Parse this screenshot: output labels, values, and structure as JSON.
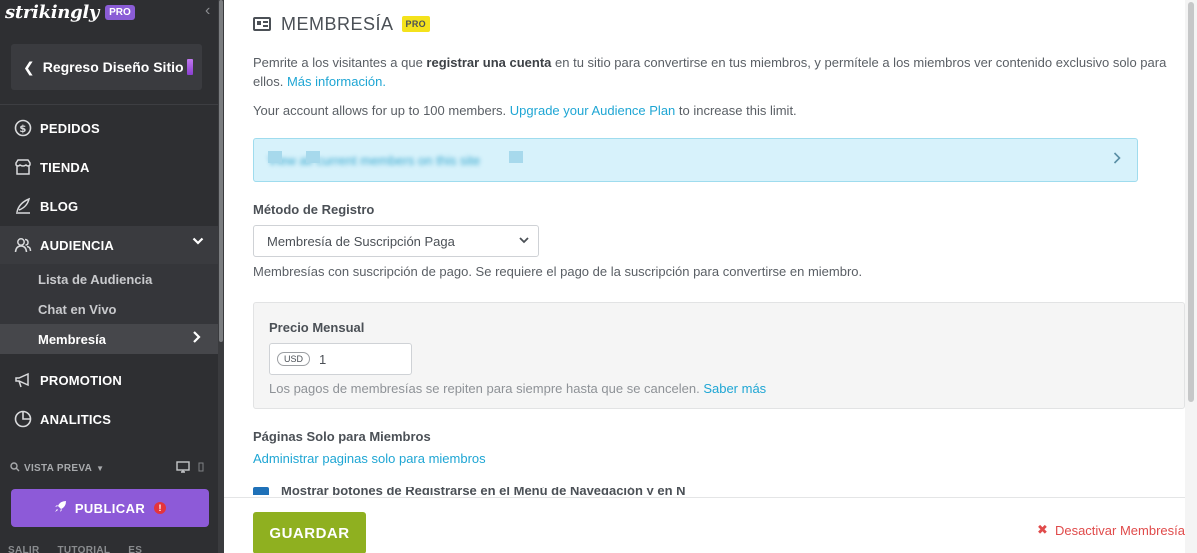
{
  "sidebar": {
    "brand": "strikingly",
    "brand_badge": "PRO",
    "back_label": "Regreso Diseño Sitio",
    "nav": [
      {
        "label": "PEDIDOS",
        "icon": "dollar-circle-icon"
      },
      {
        "label": "TIENDA",
        "icon": "store-icon"
      },
      {
        "label": "BLOG",
        "icon": "feather-pen-icon"
      },
      {
        "label": "AUDIENCIA",
        "icon": "users-icon"
      },
      {
        "label": "PROMOTION",
        "icon": "megaphone-icon"
      },
      {
        "label": "ANALITICS",
        "icon": "pie-chart-icon"
      }
    ],
    "audiencia_sub": [
      "Lista de Audiencia",
      "Chat en Vivo",
      "Membresía"
    ],
    "preview_label": "VISTA PREVA",
    "publish_label": "PUBLICAR",
    "footer_links": [
      "SALIR",
      "TUTORIAL",
      "ES"
    ]
  },
  "main": {
    "title": "MEMBRESÍA",
    "title_badge": "PRO",
    "desc_1": "Pemrite a los visitantes a que ",
    "desc_bold": "registrar una cuenta",
    "desc_2": " en tu sitio para convertirse en tus miembros, y permítele a los miembros ver contenido exclusivo solo para ellos. ",
    "desc_link": "Más información.",
    "limit_1": "Your account allows for up to 100 members. ",
    "limit_link": "Upgrade your Audience Plan",
    "limit_2": " to increase this limit.",
    "banner_text": "View all current members on this site",
    "method_label": "Método de Registro",
    "method_value": "Membresía de Suscripción Paga",
    "method_help": "Membresías con suscripción de pago. Se requiere el pago de la suscripción para convertirse en miembro.",
    "price_label": "Precio Mensual",
    "currency": "USD",
    "price_value": "1",
    "price_note": "Los pagos de membresías se repiten para siempre hasta que se cancelen. ",
    "price_note_link": "Saber más",
    "pages_label": "Páginas Solo para Miembros",
    "pages_link": "Administrar paginas solo para miembros",
    "cut_text": "Mostrar botones de Registrarse en el Menú de Navegación y en N",
    "save_label": "GUARDAR",
    "deactivate_label": "Desactivar Membresía"
  },
  "colors": {
    "sidebar_bg": "#2e2f32",
    "publish": "#8d5ad8",
    "save": "#8fb020",
    "link": "#1fa6d4",
    "danger": "#e04b4b",
    "pro_badge": "#f4e21c"
  }
}
